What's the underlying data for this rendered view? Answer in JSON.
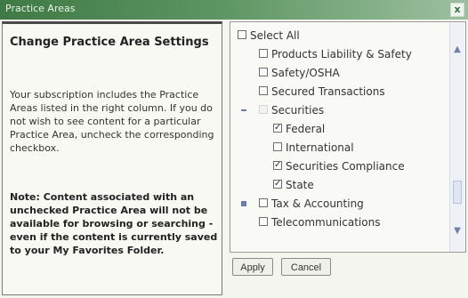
{
  "window": {
    "title": "Practice Areas",
    "close_label": "x"
  },
  "left_panel": {
    "heading": "Change Practice Area Settings",
    "description": "Your subscription includes the Practice Areas listed in the right column. If you do not wish to see content for a particular Practice Area, uncheck the corresponding checkbox.",
    "note": "Note: Content associated with an unchecked Practice Area will not be available for browsing or searching - even if the content is currently saved to your My Favorites Folder."
  },
  "practice_list": {
    "select_all": {
      "label": "Select All",
      "checked": false
    },
    "items": [
      {
        "label": "Products Liability & Safety",
        "checked": false
      },
      {
        "label": "Safety/OSHA",
        "checked": false
      },
      {
        "label": "Secured Transactions",
        "checked": false
      },
      {
        "label": "Securities",
        "checked": false,
        "expanded": true
      },
      {
        "label": "Federal",
        "checked": true
      },
      {
        "label": "International",
        "checked": false
      },
      {
        "label": "Securities Compliance",
        "checked": true
      },
      {
        "label": "State",
        "checked": true
      },
      {
        "label": "Tax & Accounting",
        "checked": false,
        "expanded": false
      },
      {
        "label": "Telecommunications",
        "checked": false
      }
    ],
    "scroll": {
      "up_icon": "scroll-up-icon",
      "down_icon": "scroll-down-icon"
    }
  },
  "buttons": {
    "apply_label": "Apply",
    "cancel_label": "Cancel"
  }
}
